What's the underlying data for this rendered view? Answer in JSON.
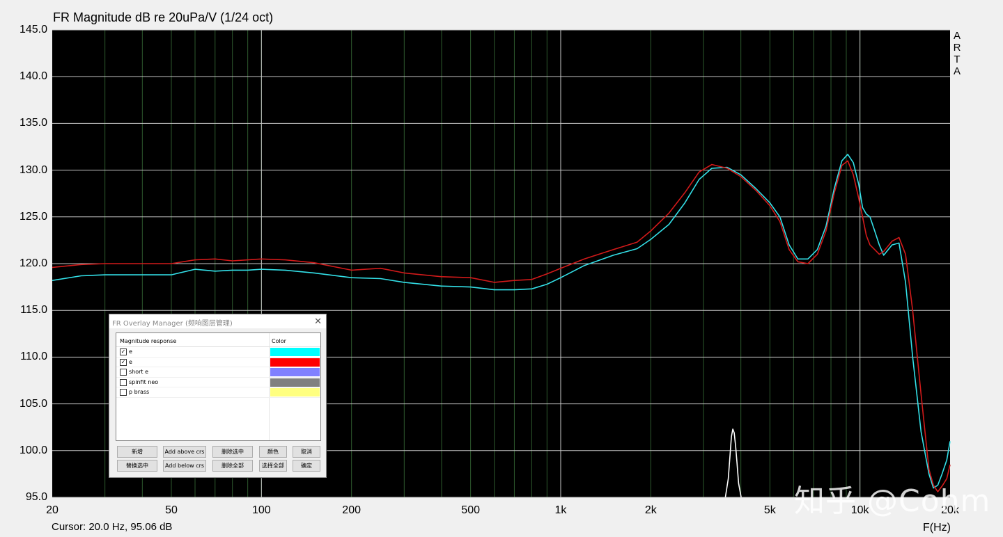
{
  "title": "FR Magnitude dB re 20uPa/V (1/24 oct)",
  "cursor_readout": "Cursor: 20.0 Hz, 95.06 dB",
  "arta_label": [
    "A",
    "R",
    "T",
    "A"
  ],
  "watermark": "知乎 @Cohm",
  "colors": {
    "background": "#000000",
    "grid_major": "#c8c8c8",
    "grid_minor": "#2e5a2e",
    "series_cyan": "#33e0e8",
    "series_red": "#d21a1a",
    "series_white": "#ffffff"
  },
  "chart_data": {
    "type": "line",
    "title": "FR Magnitude dB re 20uPa/V (1/24 oct)",
    "xlabel": "F(Hz)",
    "ylabel": "",
    "xscale": "log",
    "xlim": [
      20,
      20000
    ],
    "ylim": [
      95,
      145
    ],
    "grid": true,
    "x_tick_labels": [
      "20",
      "50",
      "100",
      "200",
      "500",
      "1k",
      "2k",
      "5k",
      "10k",
      "20k"
    ],
    "x_tick_values": [
      20,
      50,
      100,
      200,
      500,
      1000,
      2000,
      5000,
      10000,
      20000
    ],
    "y_tick_labels": [
      "145.0",
      "140.0",
      "135.0",
      "130.0",
      "125.0",
      "120.0",
      "115.0",
      "110.0",
      "105.0",
      "100.0",
      "95.0"
    ],
    "y_tick_values": [
      145,
      140,
      135,
      130,
      125,
      120,
      115,
      110,
      105,
      100,
      95
    ],
    "series": [
      {
        "name": "e",
        "color": "#33e0e8",
        "x": [
          20,
          25,
          30,
          40,
          50,
          60,
          70,
          80,
          90,
          100,
          120,
          150,
          200,
          250,
          300,
          400,
          500,
          600,
          700,
          800,
          900,
          1000,
          1200,
          1500,
          1800,
          2000,
          2300,
          2600,
          2900,
          3200,
          3600,
          4000,
          4500,
          5000,
          5400,
          5800,
          6200,
          6700,
          7200,
          7700,
          8200,
          8700,
          9100,
          9500,
          9900,
          10200,
          10500,
          10800,
          11200,
          11600,
          12000,
          12800,
          13500,
          14200,
          15000,
          16000,
          17000,
          17600,
          18200,
          18800,
          19500,
          20000
        ],
        "y": [
          118.2,
          118.7,
          118.8,
          118.8,
          118.8,
          119.4,
          119.2,
          119.3,
          119.3,
          119.4,
          119.3,
          119.0,
          118.5,
          118.4,
          118.0,
          117.6,
          117.5,
          117.2,
          117.2,
          117.3,
          117.8,
          118.5,
          119.8,
          120.9,
          121.6,
          122.6,
          124.2,
          126.5,
          129.0,
          130.2,
          130.3,
          129.5,
          128.0,
          126.5,
          125.0,
          122.0,
          120.5,
          120.5,
          121.5,
          124.0,
          128.0,
          131.0,
          131.7,
          130.8,
          128.5,
          126.0,
          125.3,
          125.0,
          123.5,
          122.0,
          120.9,
          122.0,
          122.2,
          118.0,
          110.0,
          102.0,
          97.5,
          96.0,
          96.3,
          97.5,
          99.0,
          101.0
        ]
      },
      {
        "name": "e",
        "color": "#d21a1a",
        "x": [
          20,
          25,
          30,
          40,
          50,
          60,
          70,
          80,
          90,
          100,
          120,
          150,
          200,
          250,
          300,
          400,
          500,
          600,
          700,
          800,
          900,
          1000,
          1200,
          1500,
          1800,
          2000,
          2300,
          2600,
          2900,
          3200,
          3600,
          4000,
          4500,
          5000,
          5400,
          5800,
          6200,
          6700,
          7200,
          7700,
          8200,
          8700,
          9100,
          9500,
          9900,
          10200,
          10500,
          10800,
          11200,
          11600,
          12000,
          12800,
          13500,
          14200,
          15000,
          16000,
          17000,
          17600,
          18200,
          18800,
          19500,
          20000
        ],
        "y": [
          119.6,
          119.9,
          120.0,
          120.0,
          120.0,
          120.4,
          120.5,
          120.3,
          120.4,
          120.5,
          120.4,
          120.1,
          119.3,
          119.5,
          119.0,
          118.6,
          118.5,
          118.0,
          118.2,
          118.3,
          118.9,
          119.5,
          120.5,
          121.5,
          122.3,
          123.5,
          125.4,
          127.6,
          129.8,
          130.6,
          130.2,
          129.3,
          127.8,
          126.2,
          124.5,
          121.5,
          120.2,
          120.0,
          121.0,
          123.5,
          127.5,
          130.5,
          131.0,
          129.5,
          127.0,
          125.0,
          123.0,
          122.0,
          121.5,
          121.0,
          121.3,
          122.4,
          122.8,
          121.0,
          115.0,
          106.0,
          98.0,
          96.3,
          95.6,
          96.2,
          97.0,
          98.5
        ]
      },
      {
        "name": "",
        "color": "#ffffff",
        "x": [
          3550,
          3630,
          3680,
          3720,
          3760,
          3800,
          3840,
          3880,
          3930,
          4010
        ],
        "y": [
          95.0,
          97.0,
          99.5,
          101.5,
          102.3,
          101.9,
          100.5,
          98.8,
          96.5,
          95.0
        ]
      }
    ]
  },
  "overlay_manager": {
    "title": "FR Overlay Manager (频响图层管理)",
    "close_glyph": "✕",
    "column_name": "Magnitude response",
    "column_color": "Color",
    "rows": [
      {
        "name": "e",
        "checked": "✓",
        "color": "#00ffff"
      },
      {
        "name": "e",
        "checked": "✓",
        "color": "#ff0000"
      },
      {
        "name": "short e",
        "checked": "",
        "color": "#8080ff"
      },
      {
        "name": "spinfit neo",
        "checked": "",
        "color": "#808080"
      },
      {
        "name": "p brass",
        "checked": "",
        "color": "#ffff80"
      }
    ],
    "buttons": {
      "add_new": "新增",
      "add_above": "Add above crs",
      "delete_selected": "删除选中",
      "color": "颜色",
      "cancel": "取消",
      "replace_selected": "替换选中",
      "add_below": "Add below crs",
      "delete_all": "删除全部",
      "select_all": "选择全部",
      "ok": "确定"
    }
  }
}
